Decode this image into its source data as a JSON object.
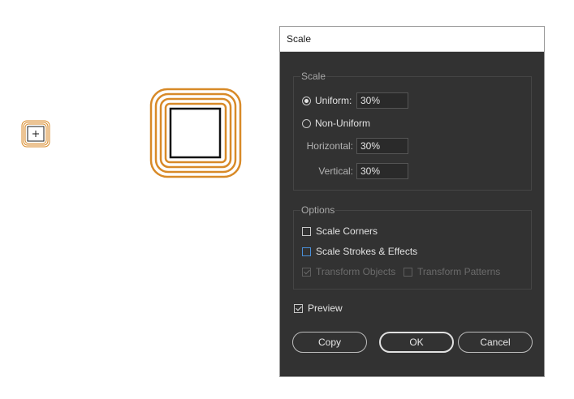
{
  "dialog": {
    "title": "Scale",
    "scale_group": {
      "label": "Scale",
      "uniform": {
        "label": "Uniform:",
        "value": "30%",
        "selected": true
      },
      "non_uniform": {
        "label": "Non-Uniform",
        "selected": false
      },
      "horizontal": {
        "label": "Horizontal:",
        "value": "30%"
      },
      "vertical": {
        "label": "Vertical:",
        "value": "30%"
      }
    },
    "options_group": {
      "label": "Options",
      "scale_corners": {
        "label": "Scale Corners",
        "checked": false
      },
      "scale_strokes": {
        "label": "Scale Strokes & Effects",
        "checked": false
      },
      "transform_objects": {
        "label": "Transform Objects",
        "checked": true,
        "enabled": false
      },
      "transform_patterns": {
        "label": "Transform Patterns",
        "checked": false,
        "enabled": false
      }
    },
    "preview": {
      "label": "Preview",
      "checked": true
    },
    "buttons": {
      "copy": "Copy",
      "ok": "OK",
      "cancel": "Cancel"
    }
  },
  "colors": {
    "artwork_stroke": "#d88a28",
    "dialog_bg": "#323232",
    "titlebar_bg": "#ffffff",
    "focus_blue": "#4a90d9"
  },
  "icons": {
    "small_artwork": "scaled-square-artwork",
    "big_artwork": "square-with-orange-outlines"
  }
}
